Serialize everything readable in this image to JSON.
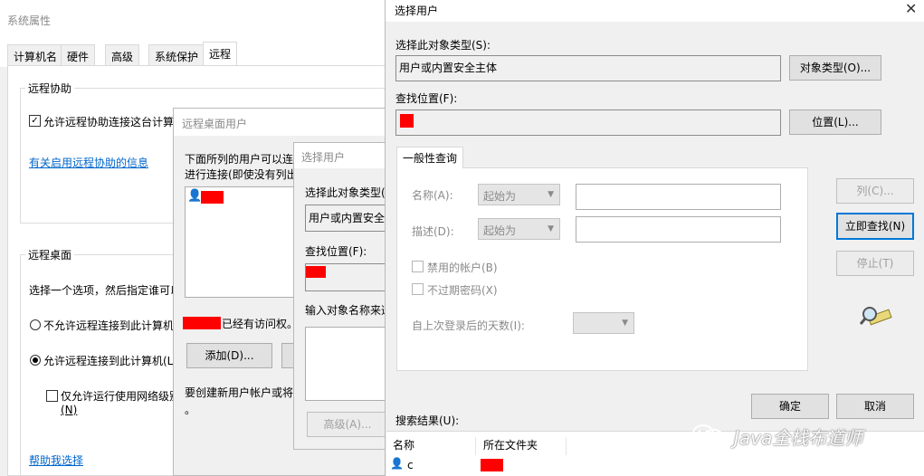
{
  "sys_props": {
    "title": "系统属性",
    "tabs": [
      "计算机名",
      "硬件",
      "高级",
      "系统保护",
      "远程"
    ],
    "remote_assist": {
      "group_label": "远程协助",
      "checkbox_label": "允许远程协助连接这台计算",
      "checked": true,
      "link": "有关启用远程协助的信息"
    },
    "remote_desktop": {
      "group_label": "远程桌面",
      "desc": "选择一个选项，然后指定谁可以",
      "option1": "不允许远程连接到此计算机",
      "option2": "允许远程连接到此计算机(L",
      "selected": 2,
      "nla_checkbox": "仅允许运行使用网络级别",
      "nla_accel": "(N)",
      "help_link": "帮助我选择"
    }
  },
  "rdp_users": {
    "title": "远程桌面用户",
    "desc_line1": "下面所列的用户可以连",
    "desc_line2": "进行连接(即使没有列出",
    "has_access": "已经有访问权。",
    "add_button": "添加(D)...",
    "footer_text": "要创建新用户帐户或将",
    "footer_dot": "。"
  },
  "select_user_small": {
    "title": "选择用户",
    "obj_type_label": "选择此对象类型(",
    "obj_type_value": "用户或内置安全",
    "location_label": "查找位置(F):",
    "enter_names_label": "输入对象名称来选",
    "advanced_button": "高级(A)..."
  },
  "select_user": {
    "title": "选择用户",
    "obj_type_label": "选择此对象类型(S):",
    "obj_type_value": "用户或内置安全主体",
    "obj_type_button": "对象类型(O)...",
    "location_label": "查找位置(F):",
    "location_button": "位置(L)...",
    "tab_label": "一般性查询",
    "name_label": "名称(A):",
    "name_combo": "起始为",
    "desc_label": "描述(D):",
    "desc_combo": "起始为",
    "disabled_accounts": "禁用的帐户(B)",
    "no_expire_pwd": "不过期密码(X)",
    "days_since_login": "自上次登录后的天数(I):",
    "columns_button": "列(C)...",
    "find_now_button": "立即查找(N)",
    "stop_button": "停止(T)",
    "ok_button": "确定",
    "cancel_button": "取消",
    "results_label": "搜索结果(U):",
    "results_columns": [
      "名称",
      "所在文件夹"
    ],
    "results_rows": [
      {
        "name": "c"
      }
    ]
  },
  "watermark": "Java全栈布道师"
}
